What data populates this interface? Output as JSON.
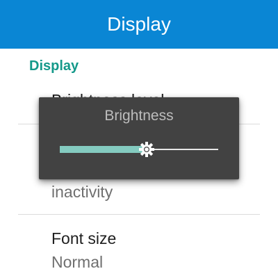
{
  "app_bar": {
    "title": "Display"
  },
  "section": {
    "header": "Display"
  },
  "preferences": [
    {
      "title": "Brightness level"
    },
    {
      "summary": "inactivity"
    },
    {
      "title": "Font size",
      "summary": "Normal"
    }
  ],
  "brightness_dialog": {
    "title": "Brightness",
    "level": 0.55,
    "thumb_icon": "brightness-sun-icon"
  },
  "colors": {
    "app_bar": "#0a86d4",
    "accent": "#14998a",
    "slider_fill": "#84cbc0",
    "dialog_background": "#424242"
  }
}
